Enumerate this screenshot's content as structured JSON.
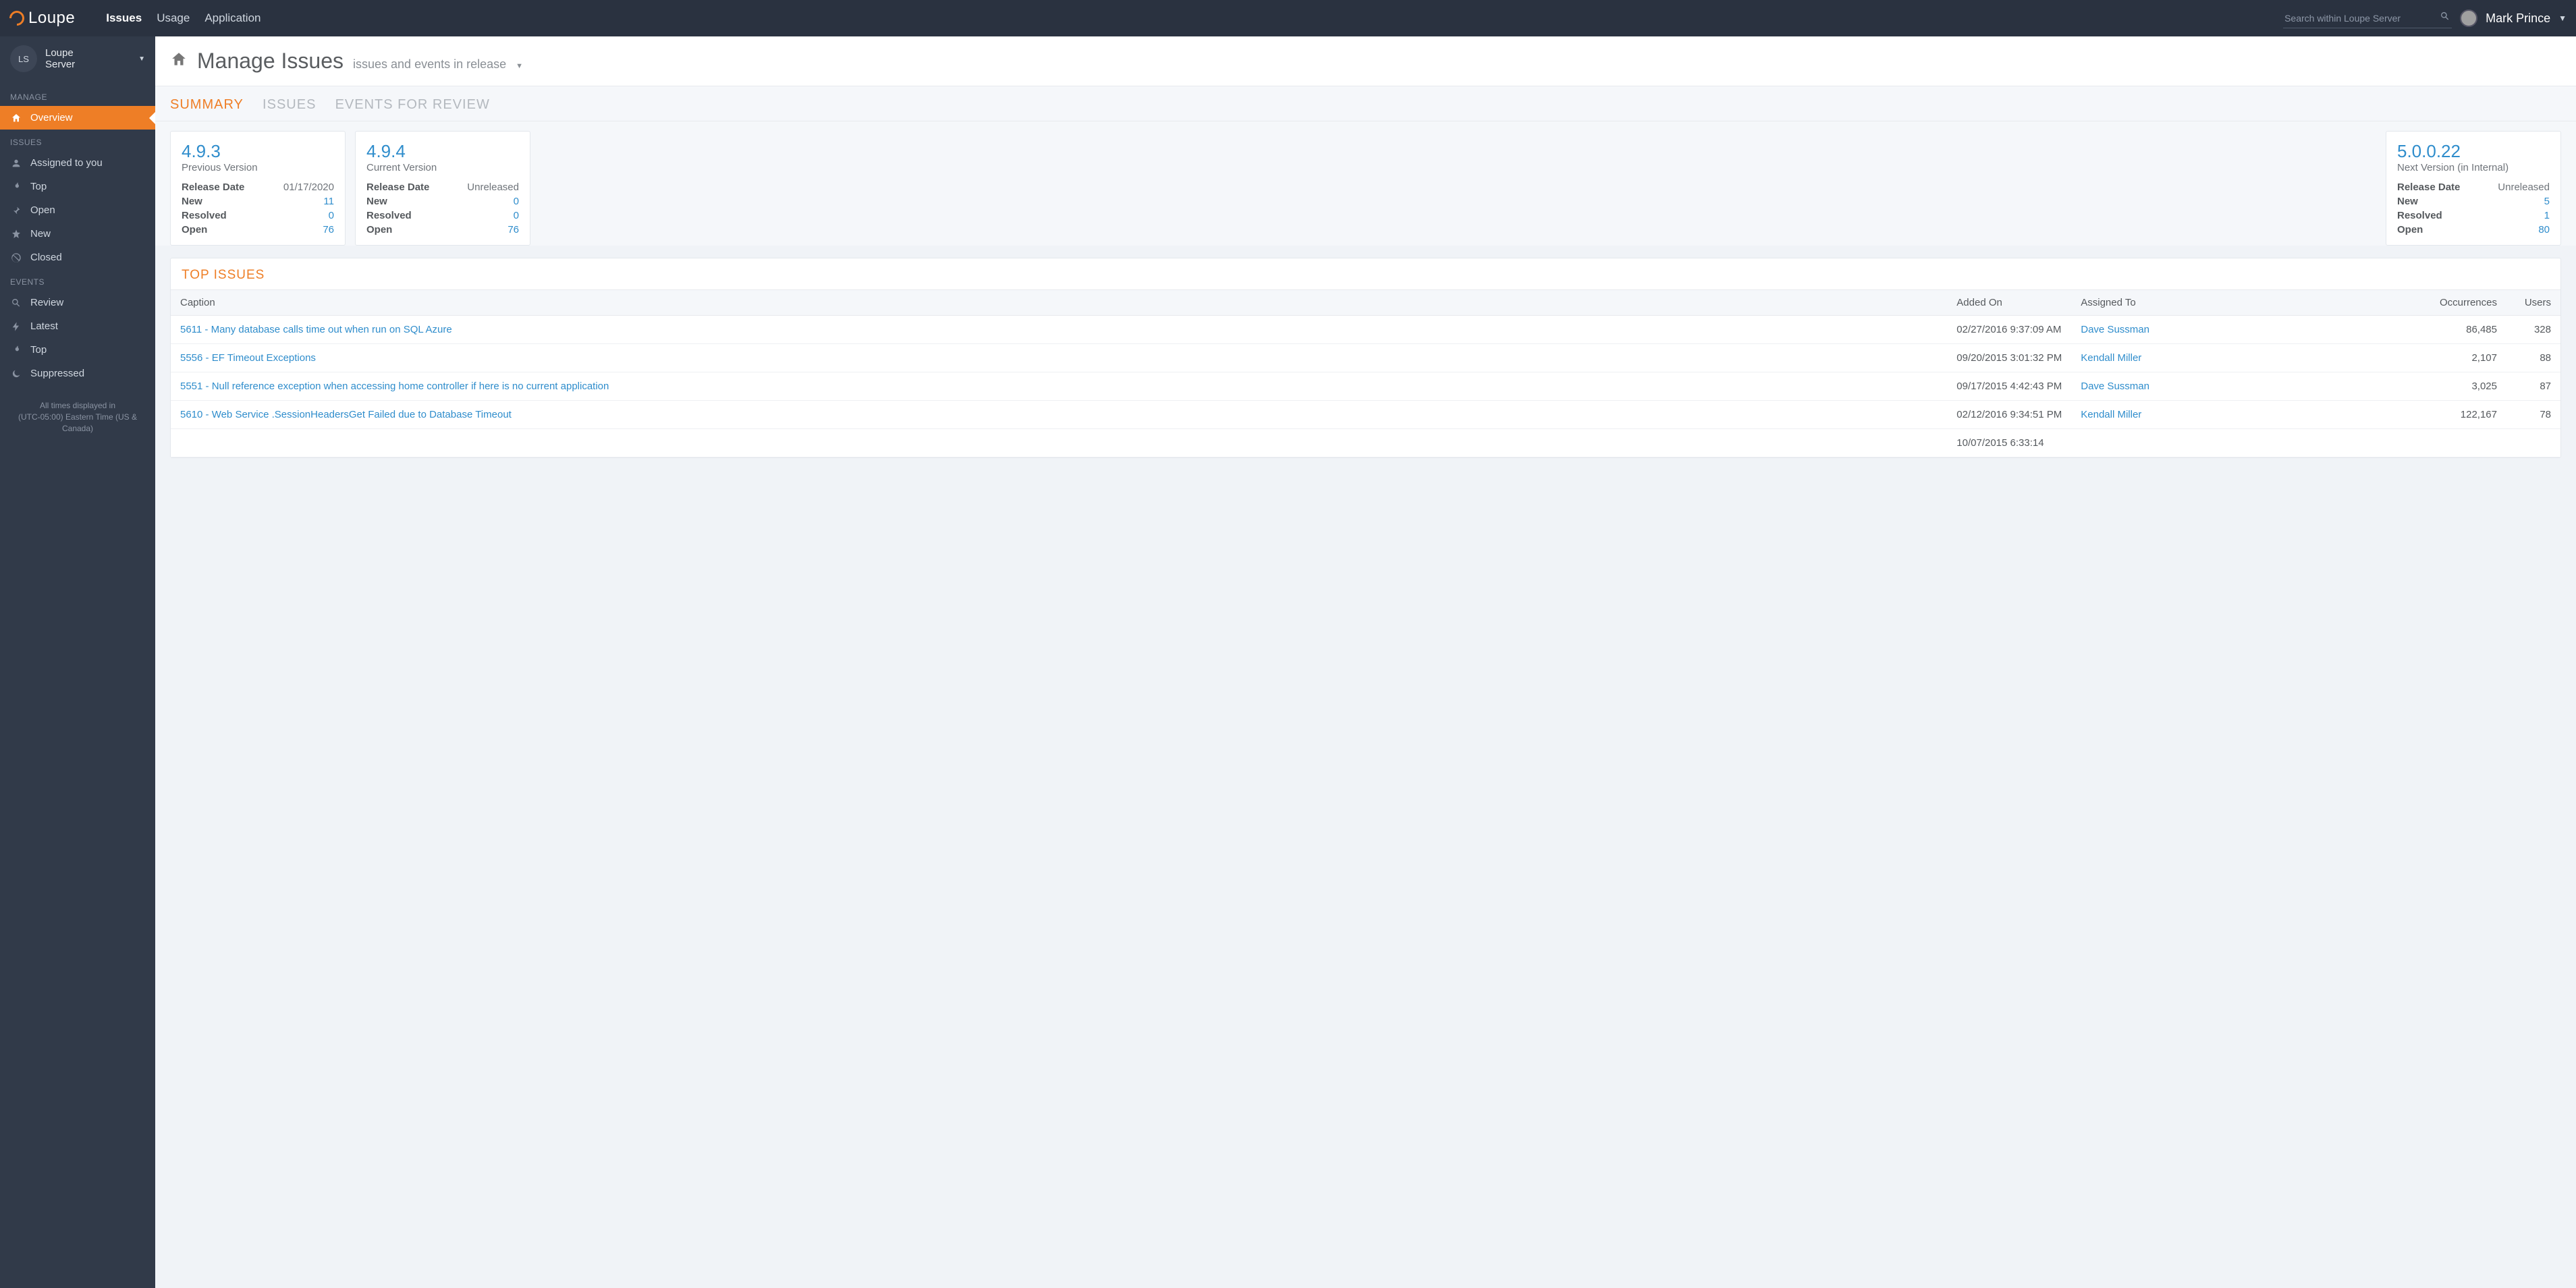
{
  "brand": "Loupe",
  "topnav": {
    "issues": "Issues",
    "usage": "Usage",
    "application": "Application"
  },
  "search": {
    "placeholder": "Search within Loupe Server"
  },
  "user": {
    "name": "Mark Prince"
  },
  "app_selector": {
    "abbrev": "LS",
    "line1": "Loupe",
    "line2": "Server"
  },
  "side": {
    "manage_header": "MANAGE",
    "overview": "Overview",
    "issues_header": "ISSUES",
    "assigned": "Assigned to you",
    "top": "Top",
    "open": "Open",
    "new": "New",
    "closed": "Closed",
    "events_header": "EVENTS",
    "review": "Review",
    "latest": "Latest",
    "etop": "Top",
    "suppressed": "Suppressed"
  },
  "tz": {
    "l1": "All times displayed in",
    "l2": "(UTC-05:00) Eastern Time (US & Canada)"
  },
  "page": {
    "title": "Manage Issues",
    "subtitle": "issues and events in release"
  },
  "tabs": {
    "summary": "SUMMARY",
    "issues": "ISSUES",
    "events": "EVENTS FOR REVIEW"
  },
  "versions": [
    {
      "ver": "4.9.3",
      "sub": "Previous Version",
      "release_k": "Release Date",
      "release_v": "01/17/2020",
      "new_k": "New",
      "new_v": "11",
      "res_k": "Resolved",
      "res_v": "0",
      "open_k": "Open",
      "open_v": "76"
    },
    {
      "ver": "4.9.4",
      "sub": "Current Version",
      "release_k": "Release Date",
      "release_v": "Unreleased",
      "new_k": "New",
      "new_v": "0",
      "res_k": "Resolved",
      "res_v": "0",
      "open_k": "Open",
      "open_v": "76"
    },
    {
      "ver": "5.0.0.22",
      "sub": "Next Version (in Internal)",
      "release_k": "Release Date",
      "release_v": "Unreleased",
      "new_k": "New",
      "new_v": "5",
      "res_k": "Resolved",
      "res_v": "1",
      "open_k": "Open",
      "open_v": "80"
    }
  ],
  "top_issues_title": "TOP ISSUES",
  "columns": {
    "caption": "Caption",
    "added": "Added On",
    "assigned": "Assigned To",
    "occurrences": "Occurrences",
    "users": "Users"
  },
  "rows": [
    {
      "caption": "5611 - Many database calls time out when run on SQL Azure",
      "added": "02/27/2016 9:37:09 AM",
      "assigned": "Dave Sussman",
      "occ": "86,485",
      "users": "328"
    },
    {
      "caption": "5556 - EF Timeout Exceptions",
      "added": "09/20/2015 3:01:32 PM",
      "assigned": "Kendall Miller",
      "occ": "2,107",
      "users": "88"
    },
    {
      "caption": "5551 - Null reference exception when accessing home controller if here is no current application",
      "added": "09/17/2015 4:42:43 PM",
      "assigned": "Dave Sussman",
      "occ": "3,025",
      "users": "87"
    },
    {
      "caption": "5610 - Web Service .SessionHeadersGet Failed due to Database Timeout",
      "added": "02/12/2016 9:34:51 PM",
      "assigned": "Kendall Miller",
      "occ": "122,167",
      "users": "78"
    },
    {
      "caption": "",
      "added": "10/07/2015 6:33:14",
      "assigned": "",
      "occ": "",
      "users": ""
    }
  ]
}
